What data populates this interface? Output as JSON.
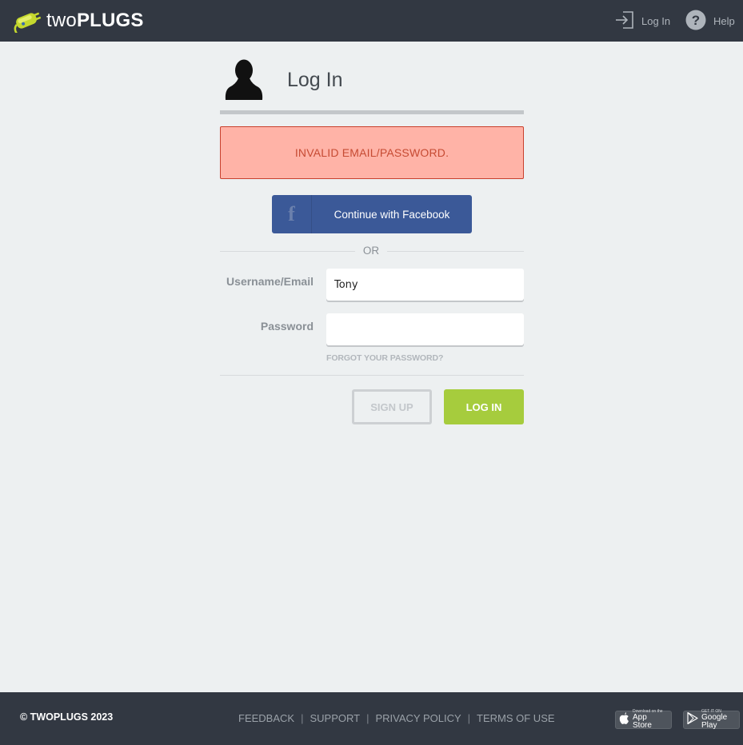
{
  "header": {
    "brand_prefix": "two",
    "brand_suffix": "PLUGS",
    "nav": {
      "login_label": "Log In",
      "help_label": "Help"
    }
  },
  "login_card": {
    "title": "Log In",
    "error_message": "INVALID EMAIL/PASSWORD.",
    "facebook_button_label": "Continue with Facebook",
    "facebook_icon_glyph": "f",
    "divider_text": "OR",
    "username_label": "Username/Email",
    "username_value": "Tony",
    "password_label": "Password",
    "password_value": "",
    "forgot_password_label": "FORGOT YOUR PASSWORD?",
    "signup_button_label": "SIGN UP",
    "login_button_label": "LOG IN"
  },
  "footer": {
    "copyright": "© TWOPLUGS 2023",
    "links": [
      "FEEDBACK",
      "SUPPORT",
      "PRIVACY POLICY",
      "TERMS OF USE"
    ],
    "separator": "|",
    "app_store": {
      "small": "Download on the",
      "big": "App Store"
    },
    "google_play": {
      "small": "GET IT ON",
      "big": "Google Play"
    }
  },
  "colors": {
    "topbar": "#323842",
    "background": "#edf0f1",
    "error_bg": "#ffb3a7",
    "error_text": "#c64b33",
    "facebook": "#3b5998",
    "login_green": "#a6cc3d"
  },
  "icons": [
    "plug-logo-icon",
    "login-arrow-icon",
    "help-question-icon",
    "user-silhouette-icon",
    "facebook-icon",
    "apple-icon",
    "google-play-icon"
  ]
}
